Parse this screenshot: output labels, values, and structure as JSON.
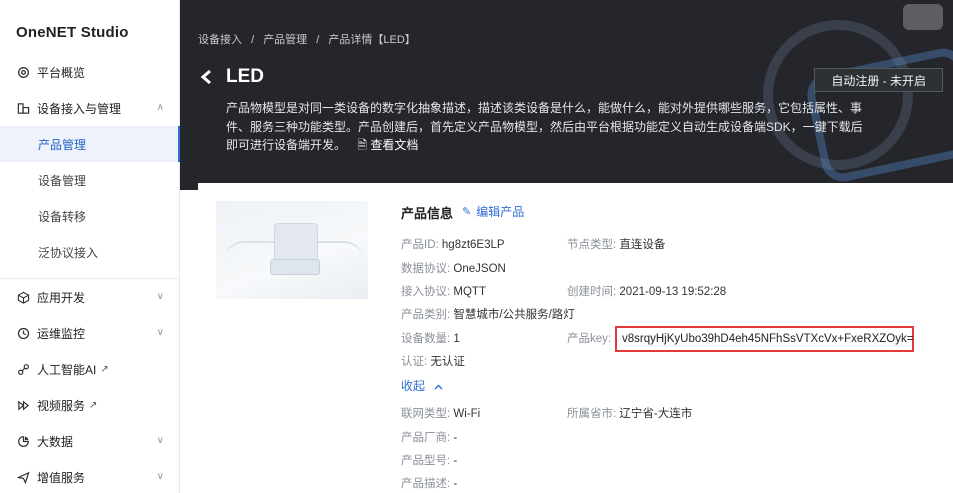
{
  "app": {
    "brand": "OneNET Studio"
  },
  "sidebar": {
    "items": [
      {
        "label": "平台概览",
        "icon": "gear-icon"
      },
      {
        "label": "设备接入与管理",
        "icon": "device-icon",
        "chevron": "∧"
      },
      {
        "label": "应用开发",
        "icon": "cube-icon",
        "chevron": "∨"
      },
      {
        "label": "运维监控",
        "icon": "clock-icon",
        "chevron": "∨"
      },
      {
        "label": "人工智能AI",
        "icon": "ai-icon",
        "ext": "↗"
      },
      {
        "label": "视频服务",
        "icon": "video-icon",
        "ext": "↗"
      },
      {
        "label": "大数据",
        "icon": "bigdata-icon",
        "chevron": "∨"
      },
      {
        "label": "增值服务",
        "icon": "send-icon",
        "chevron": "∨"
      }
    ],
    "subitems": [
      {
        "label": "产品管理",
        "active": true
      },
      {
        "label": "设备管理"
      },
      {
        "label": "设备转移"
      },
      {
        "label": "泛协议接入"
      }
    ]
  },
  "header": {
    "breadcrumb": [
      "设备接入",
      "/",
      "产品管理",
      "/",
      "产品详情【LED】"
    ],
    "title": "LED",
    "description": "产品物模型是对同一类设备的数字化抽象描述，描述该类设备是什么，能做什么，能对外提供哪些服务，它包括属性、事件、服务三种功能类型。产品创建后，首先定义产品物模型，然后由平台根据功能定义自动生成设备端SDK，一键下载后即可进行设备端开发。",
    "doc_link": "查看文档",
    "auto_register": "自动注册 - 未开启"
  },
  "product": {
    "section_title": "产品信息",
    "edit_label": "编辑产品",
    "fields": {
      "product_id": {
        "k": "产品ID:",
        "v": "hg8zt6E3LP"
      },
      "node_type": {
        "k": "节点类型:",
        "v": "直连设备"
      },
      "data_protocol": {
        "k": "数据协议:",
        "v": "OneJSON"
      },
      "access_protocol": {
        "k": "接入协议:",
        "v": "MQTT"
      },
      "created_time": {
        "k": "创建时间:",
        "v": "2021-09-13 19:52:28"
      },
      "category": {
        "k": "产品类别:",
        "v": "智慧城市/公共服务/路灯"
      },
      "device_count": {
        "k": "设备数量:",
        "v": "1"
      },
      "product_key": {
        "k": "产品key:",
        "v": "v8srqyHjKyUbo39hD4eh45NFhSsVTXcVx+FxeRXZOyk="
      },
      "auth": {
        "k": "认证:",
        "v": "无认证"
      },
      "network": {
        "k": "联网类型:",
        "v": "Wi-Fi"
      },
      "region": {
        "k": "所属省市:",
        "v": "辽宁省-大连市"
      },
      "vendor": {
        "k": "产品厂商:",
        "v": "-"
      },
      "model": {
        "k": "产品型号:",
        "v": "-"
      },
      "description": {
        "k": "产品描述:",
        "v": "-"
      }
    },
    "collapse_label": "收起"
  }
}
